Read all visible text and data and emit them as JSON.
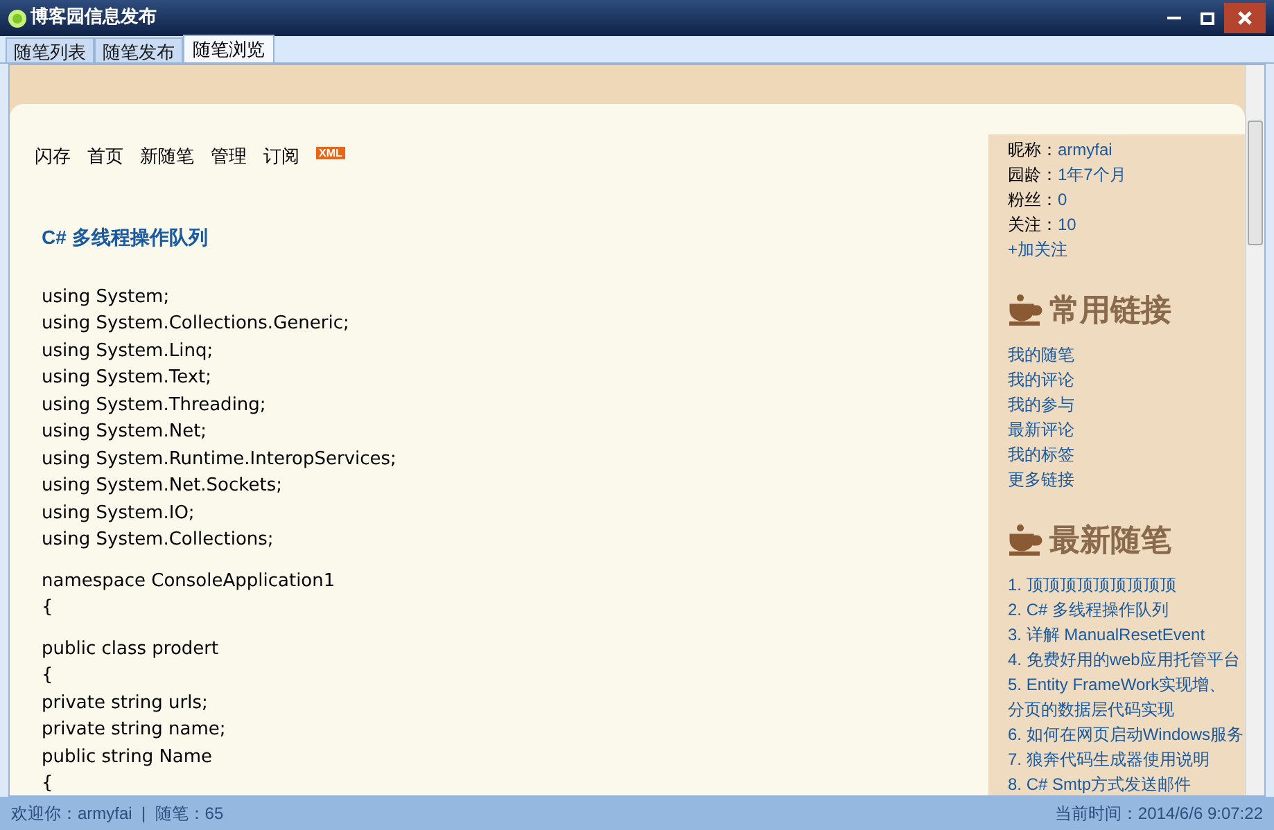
{
  "window": {
    "title": "博客园信息发布"
  },
  "tabs": [
    {
      "label": "随笔列表",
      "selected": false
    },
    {
      "label": "随笔发布",
      "selected": false
    },
    {
      "label": "随笔浏览",
      "selected": true
    }
  ],
  "nav": {
    "items": [
      "闪存",
      "首页",
      "新随笔",
      "管理",
      "订阅"
    ],
    "badge": "XML"
  },
  "post": {
    "title": "C# 多线程操作队列",
    "blocks": [
      [
        "using System;",
        "using System.Collections.Generic;",
        "using System.Linq;",
        "using System.Text;",
        "using System.Threading;",
        "using System.Net;",
        "using System.Runtime.InteropServices;",
        "using System.Net.Sockets;",
        "using System.IO;",
        "using System.Collections;"
      ],
      [
        "namespace ConsoleApplication1",
        "{"
      ],
      [
        "public class prodert",
        "{",
        "private string urls;",
        "private string name;",
        "public string Name",
        "{"
      ]
    ]
  },
  "profile": [
    {
      "label": "昵称：",
      "value": "armyfai"
    },
    {
      "label": "园龄：",
      "value": "1年7个月"
    },
    {
      "label": "粉丝：",
      "value": "0"
    },
    {
      "label": "关注：",
      "value": "10"
    }
  ],
  "follow_link": "+加关注",
  "links_section": {
    "title": "常用链接",
    "items": [
      "我的随笔",
      "我的评论",
      "我的参与",
      "最新评论",
      "我的标签",
      "更多链接"
    ]
  },
  "recent_section": {
    "title": "最新随笔",
    "items": [
      "1. 顶顶顶顶顶顶顶顶顶",
      "2. C# 多线程操作队列",
      "3. 详解 ManualResetEvent",
      "4. 免费好用的web应用托管平台",
      "5. Entity FrameWork实现增、",
      "分页的数据层代码实现",
      "6. 如何在网页启动Windows服务",
      "7. 狼奔代码生成器使用说明",
      "8. C# Smtp方式发送邮件"
    ]
  },
  "status_bar": {
    "left": "欢迎你：armyfai  |  随笔：65",
    "right": "当前时间：2014/6/6 9:07:22"
  }
}
